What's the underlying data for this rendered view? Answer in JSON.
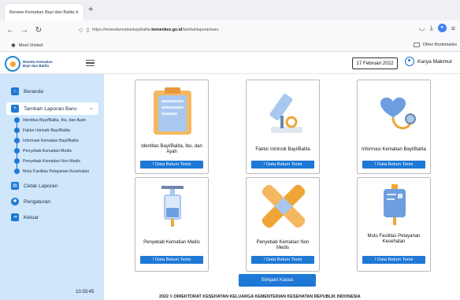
{
  "browser": {
    "tab_title": "Review Kematian Bayi dan Balita",
    "url_prefix": "https://reviewkematianbayibalita.",
    "url_domain": "kemenkes.go.id",
    "url_path": "/tambahlaporanbaru",
    "bookmark_left": "Most Visited",
    "bookmark_right": "Other Bookmarks"
  },
  "header": {
    "logo_text_line1": "Review Kematian",
    "logo_text_line2": "Bayi dan Balita",
    "date": "17 Februari 2022",
    "user_name": "Karya Makmur"
  },
  "sidebar": {
    "beranda": "Beranda",
    "tambah": "Tambah Laporan Baru",
    "sub_items": [
      "Identitas Bayi/Balita, Ibu, dan Ayah",
      "Faktor Intrinsik Bayi/Balita",
      "Informasi Kematian Bayi/Balita",
      "Penyebab Kematian Medis",
      "Penyebab Kematian Non Medis",
      "Mutu Fasilitas Pelayanan Kesehatan"
    ],
    "cetak": "Cetak Laporan",
    "pengaturan": "Pengaturan",
    "keluar": "Keluar",
    "clock": "10:33:45"
  },
  "cards": [
    {
      "title": "Identitas Bayi/Balita, Ibu, dan Ayah",
      "badge": "! Data Belum Terisi",
      "icon": "clipboard-icon"
    },
    {
      "title": "Faktor Intrinsik Bayi/Balita",
      "badge": "! Data Belum Terisi",
      "icon": "microscope-icon"
    },
    {
      "title": "Informasi Kematian Bayi/Balita",
      "badge": "! Data Belum Terisi",
      "icon": "stethoscope-icon"
    },
    {
      "title": "Penyebab Kematian Medis",
      "badge": "! Data Belum Terisi",
      "icon": "syringe-icon"
    },
    {
      "title": "Penyebab Kematian Non Medis",
      "badge": "! Data Belum Terisi",
      "icon": "bandage-icon"
    },
    {
      "title": "Mutu Fasilitas Pelayanan Kesehatan",
      "badge": "! Data Belum Terisi",
      "icon": "iv-bag-icon"
    }
  ],
  "save_button": "Simpan Kasus",
  "footer": "2022 © DIREKTORAT KESEHATAN KELUARGA KEMENTERIAN KESEHATAN REPUBLIK INDONESIA",
  "colors": {
    "primary": "#1e78d6",
    "sidebar_bg": "#cfe6fb",
    "accent_orange": "#f0a636"
  }
}
